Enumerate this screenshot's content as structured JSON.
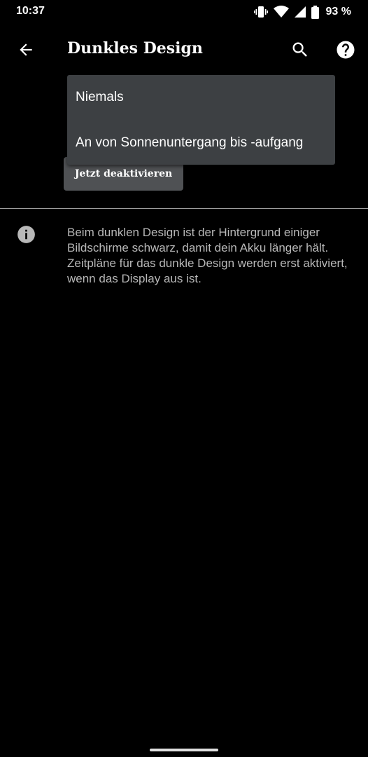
{
  "status_bar": {
    "time": "10:37",
    "battery": "93 %",
    "icons": [
      "vibrate-icon",
      "wifi-icon",
      "cell-signal-icon",
      "battery-icon"
    ]
  },
  "app_bar": {
    "title": "Dunkles Design",
    "icons": [
      "back-arrow-icon",
      "search-icon",
      "help-icon"
    ]
  },
  "dropdown": {
    "items": [
      {
        "label": "Niemals"
      },
      {
        "label": "An von Sonnenuntergang bis -aufgang"
      }
    ]
  },
  "deactivate_button": {
    "label": "Jetzt deaktivieren"
  },
  "info": {
    "icon": "info-icon",
    "text": "Beim dunklen Design ist der Hintergrund einiger Bildschirme schwarz, damit dein Akku länger hält. Zeitpläne für das dunkle Design werden erst aktiviert, wenn das Display aus ist."
  },
  "colors": {
    "background": "#000000",
    "menu_surface": "#3d4043",
    "button_surface": "#4f5154",
    "secondary_text": "#b8b8b8"
  }
}
